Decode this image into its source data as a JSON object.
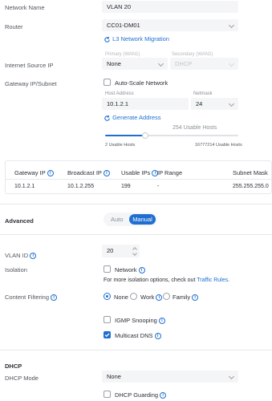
{
  "network_name": {
    "label": "Network Name",
    "value": "VLAN 20"
  },
  "router": {
    "label": "Router",
    "value": "CC01-DM01",
    "migration_link": "L3 Network Migration"
  },
  "internet_source": {
    "label": "Internet Source IP",
    "primary_header": "Primary (WAN1)",
    "secondary_header": "Secondary (WAN2)",
    "primary_value": "None",
    "secondary_value": "DHCP"
  },
  "gateway": {
    "label": "Gateway IP/Subnet",
    "auto_scale_label": "Auto-Scale Network",
    "host_address_label": "Host Address",
    "host_address_value": "10.1.2.1",
    "netmask_label": "Netmask",
    "netmask_value": "24",
    "generate_link": "Generate Address",
    "usable_hosts_center": "254 Usable Hosts",
    "usable_hosts_min": "2 Usable Hosts",
    "usable_hosts_max": "16777214 Usable Hosts",
    "slider_position": 0.3
  },
  "summary_table": {
    "headers": [
      "Gateway IP",
      "Broadcast IP",
      "Usable IPs",
      "IP Range",
      "Subnet Mask"
    ],
    "row": [
      "10.1.2.1",
      "10.1.2.255",
      "199",
      "-",
      "255.255.255.0"
    ]
  },
  "advanced": {
    "label": "Advanced",
    "auto_label": "Auto",
    "manual_label": "Manual",
    "selected": "Manual"
  },
  "vlan_id": {
    "label": "VLAN ID",
    "value": "20"
  },
  "isolation": {
    "label": "Isolation",
    "network_label": "Network",
    "hint_prefix": "For more isolation options, check out",
    "hint_link": "Traffic Rules",
    "hint_suffix": "."
  },
  "content_filtering": {
    "label": "Content Filtering",
    "options": [
      "None",
      "Work",
      "Family"
    ],
    "selected": "None"
  },
  "igmp": {
    "label": "IGMP Snooping",
    "checked": false
  },
  "mdns": {
    "label": "Multicast DNS",
    "checked": true
  },
  "dhcp": {
    "section_label": "DHCP",
    "mode_label": "DHCP Mode",
    "mode_value": "None",
    "guarding_label": "DHCP Guarding"
  },
  "colors": {
    "accent": "#1f6fd1",
    "field_bg": "#f4f5f6"
  }
}
